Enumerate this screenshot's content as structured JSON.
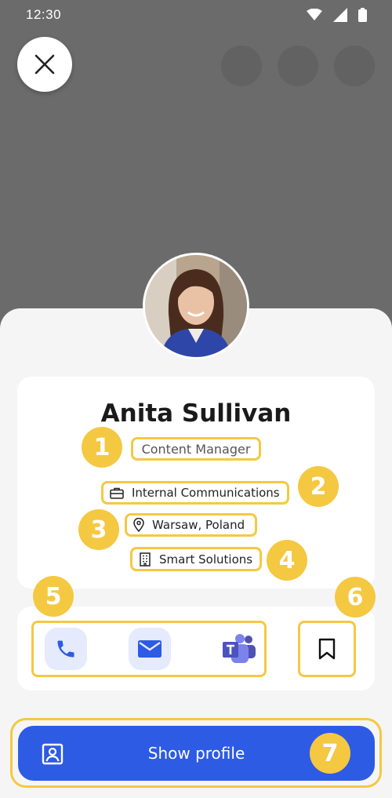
{
  "status_bar": {
    "time": "12:30",
    "icons": [
      "wifi-icon",
      "signal-icon",
      "battery-icon"
    ]
  },
  "header": {
    "close_icon": "close-icon",
    "ghost_actions": [
      "action-1",
      "action-2",
      "action-3"
    ]
  },
  "profile": {
    "name": "Anita Sullivan",
    "title": "Content Manager",
    "department": "Internal Communications",
    "location": "Warsaw, Poland",
    "company": "Smart Solutions"
  },
  "actions": {
    "call_icon": "phone-icon",
    "email_icon": "mail-icon",
    "teams_icon": "teams-icon",
    "bookmark_icon": "bookmark-icon"
  },
  "show_profile": {
    "label": "Show profile",
    "icon": "contact-card-icon"
  },
  "annotations": [
    "1",
    "2",
    "3",
    "4",
    "5",
    "6",
    "7"
  ],
  "colors": {
    "accent": "#2d5be3",
    "highlight": "#f5c842",
    "action_bg": "#e5eafc",
    "teams": "#5b5fc7"
  }
}
